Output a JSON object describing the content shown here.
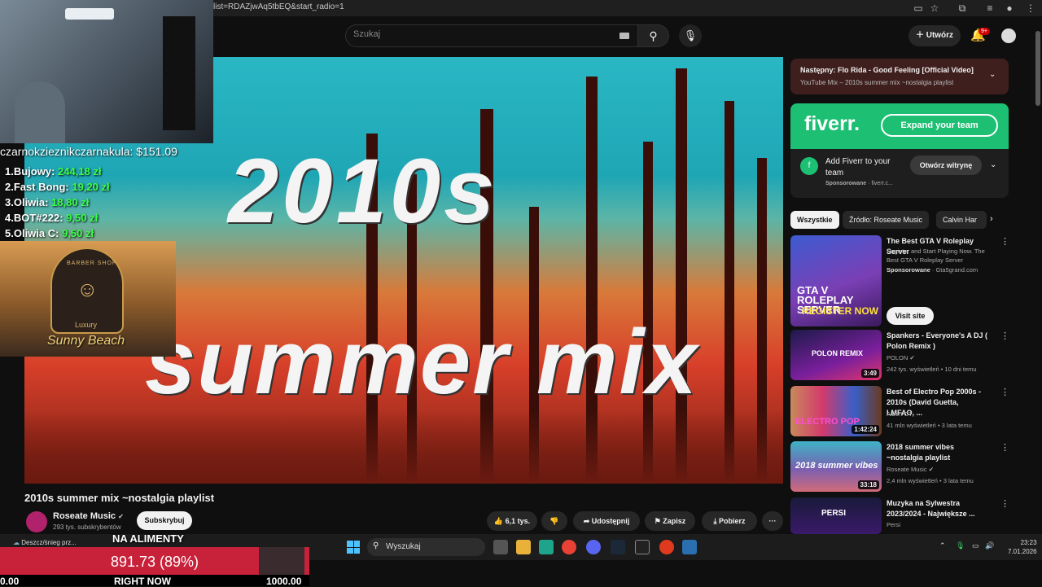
{
  "browser": {
    "url": "list=RDAZjwAq5tbEQ&start_radio=1"
  },
  "header": {
    "search_placeholder": "Szukaj",
    "create_label": "Utwórz",
    "notif_count": "9+"
  },
  "video": {
    "overlay_line1": "2010s",
    "overlay_line2": "summer mix",
    "title": "2010s summer mix ~nostalgia playlist",
    "channel": "Roseate Music",
    "subscribers": "293 tys. subskrybentów",
    "subscribe_label": "Subskrybuj",
    "likes": "6,1 tys.",
    "share_label": "Udostępnij",
    "save_label": "Zapisz",
    "download_label": "Pobierz",
    "more": "···"
  },
  "up_next": {
    "title": "Następny: Flo Rida - Good Feeling [Official Video]",
    "subtitle": "YouTube Mix – 2010s summer mix ~nostalgia playlist"
  },
  "ad": {
    "logo": "fiverr.",
    "expand_label": "Expand your team",
    "headline": "Add Fiverr to your team",
    "sponsored": "Sponsorowane",
    "domain": "fiverr.c...",
    "open_label": "Otwórz witrynę"
  },
  "chips": [
    "Wszystkie",
    "Źródło: Roseate Music",
    "Calvin Har"
  ],
  "related": [
    {
      "title": "The Best GTA V Roleplay Server",
      "line2": "Register and Start Playing Now. The Best GTA V Roleplay Server",
      "sponsored": "Sponsorowane",
      "domain": "Gta5grand.com",
      "cta": "Visit site",
      "thumb_text": "GTA V ROLEPLAY SERVER",
      "thumb_text2": "REGISTER NOW"
    },
    {
      "title": "Spankers - Everyone's A DJ ( Polon Remix )",
      "channel": "POLON",
      "meta": "242 tys. wyświetleń • 10 dni temu",
      "duration": "3:49",
      "thumb_text": "POLON REMIX"
    },
    {
      "title": "Best of Electro Pop 2000s - 2010s (David Guetta, LMFAO, ...",
      "channel": "Albert CT",
      "meta": "41 mln wyświetleń • 3 lata temu",
      "duration": "1:42:24",
      "thumb_text": "ELECTRO POP"
    },
    {
      "title": "2018 summer vibes ~nostalgia playlist",
      "channel": "Roseate Music",
      "meta": "2,4 mln wyświetleń • 3 lata temu",
      "duration": "33:18",
      "thumb_text": "2018 summer vibes"
    },
    {
      "title": "Muzyka na Sylwestra 2023/2024 - Największe ...",
      "channel": "Persi",
      "thumb_text": "PERSI"
    }
  ],
  "overlay": {
    "donor_header": "czarnokzieznikczarnakula: $151.09",
    "donors": [
      {
        "rank": "1.Bujowy:",
        "amount": "244,18 zł"
      },
      {
        "rank": "2.Fast Bong:",
        "amount": "19,20 zł"
      },
      {
        "rank": "3.Oliwia:",
        "amount": "18,80 zł"
      },
      {
        "rank": "4.BOT#222:",
        "amount": "9,50 zł"
      },
      {
        "rank": "5.Oliwia C:",
        "amount": "9,50 zł"
      }
    ],
    "logo_top": "BARBER SHOP",
    "logo_mid": "Luxury",
    "logo_script": "Sunny Beach",
    "goal_title": "NA ALIMENTY",
    "goal_value": "891.73 (89%)",
    "goal_fraction": 0.89,
    "goal_min": "0.00",
    "goal_now": "RIGHT NOW",
    "goal_max": "1000.00"
  },
  "taskbar": {
    "weather": "Deszcz/śnieg prz...",
    "search": "Wyszukaj",
    "time": "23:23",
    "date": "7.01.2026"
  }
}
